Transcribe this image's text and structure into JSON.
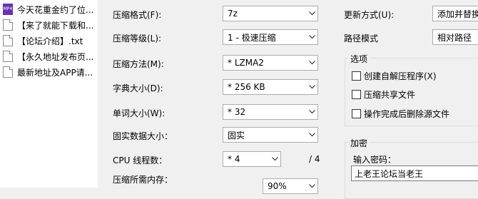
{
  "files": [
    {
      "name": "今天花重金约了位...",
      "type": "video"
    },
    {
      "name": "【来了就能下载和...",
      "type": "doc"
    },
    {
      "name": "【论坛介绍】.txt",
      "type": "doc"
    },
    {
      "name": "【永久地址发布页...",
      "type": "doc"
    },
    {
      "name": "最新地址及APP请...",
      "type": "doc"
    }
  ],
  "video_icon_text": "MP4",
  "settings": {
    "archive_format": {
      "label": "压缩格式(F):",
      "value": "7z"
    },
    "compression_level": {
      "label": "压缩等级(L):",
      "value": "1 - 极速压缩"
    },
    "compression_method": {
      "label": "压缩方法(M):",
      "value": "* LZMA2"
    },
    "dictionary_size": {
      "label": "字典大小(D):",
      "value": "* 256 KB"
    },
    "word_size": {
      "label": "单词大小(W):",
      "value": "* 32"
    },
    "solid_block_size": {
      "label": "固实数据大小：",
      "value": "固实"
    },
    "cpu_threads": {
      "label": "CPU 线程数：",
      "value": "* 4",
      "total": "/ 4"
    },
    "memory_usage": {
      "label": "压缩所需内存：",
      "value": "90%"
    }
  },
  "right": {
    "update_mode": {
      "label": "更新方式(U):",
      "value": "添加并替换"
    },
    "path_mode": {
      "label": "路径模式",
      "value": "相对路径"
    },
    "options": {
      "title": "选项",
      "items": [
        {
          "label": "创建自解压程序(X)",
          "checked": false
        },
        {
          "label": "压缩共享文件",
          "checked": false
        },
        {
          "label": "操作完成后删除源文件",
          "checked": false
        }
      ]
    },
    "encryption": {
      "title": "加密",
      "password_label": "输入密码：",
      "password_value": "上老王论坛当老王"
    }
  }
}
